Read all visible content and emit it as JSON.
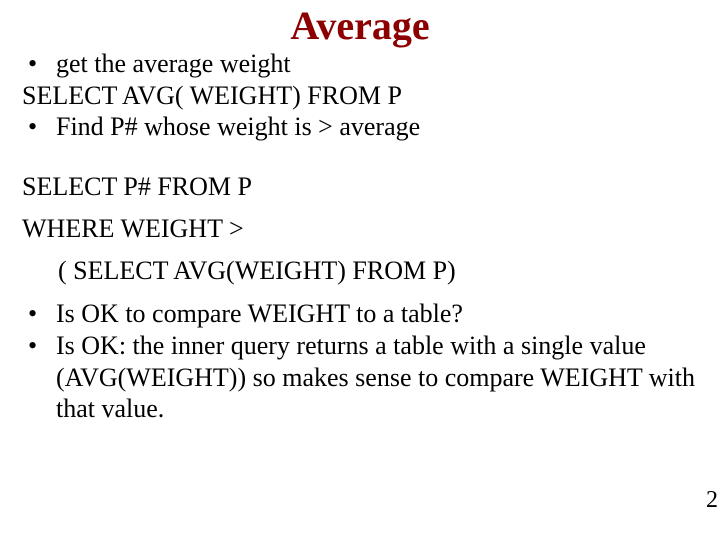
{
  "title": "Average",
  "lines": {
    "b1": "get the average weight",
    "l1": "SELECT  AVG( WEIGHT) FROM P",
    "b2": "Find P# whose weight is > average",
    "l2": "SELECT  P# FROM P",
    "l3": "WHERE  WEIGHT >",
    "l4": "( SELECT AVG(WEIGHT)  FROM P)",
    "b3": " Is OK to compare WEIGHT to a table?",
    "b4": "Is OK: the inner query returns a table with a single value (AVG(WEIGHT)) so makes sense to compare WEIGHT with that value."
  },
  "bullet_char": "•",
  "page_number": "2"
}
